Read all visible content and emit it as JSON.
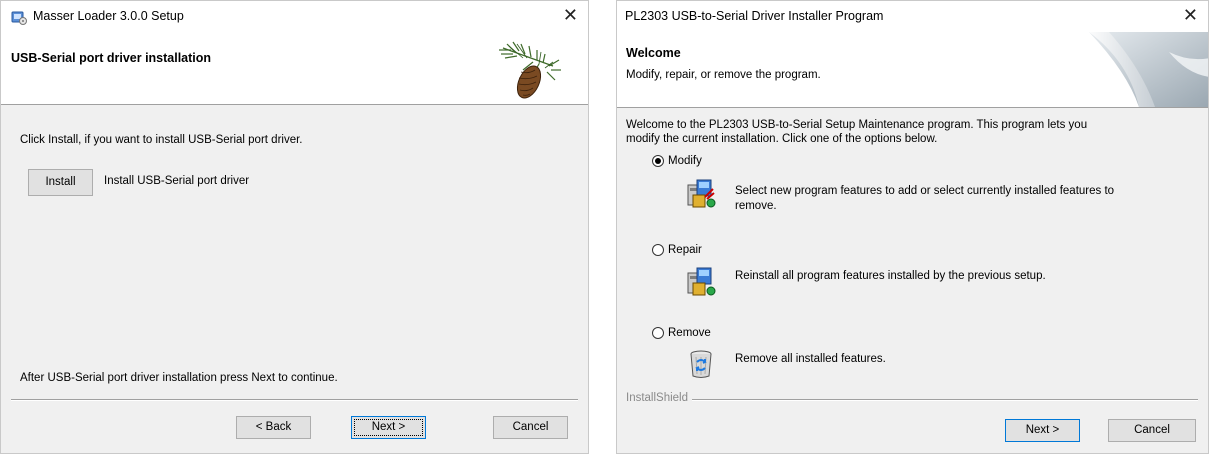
{
  "left": {
    "title": "Masser Loader 3.0.0 Setup",
    "header": "USB-Serial port driver installation",
    "instruction": "Click Install, if you want to install USB-Serial port driver.",
    "install_button": "Install",
    "install_desc": "Install USB-Serial port driver",
    "footer_note": "After USB-Serial port driver installation press Next to continue.",
    "back_button": "< Back",
    "next_button": "Next >",
    "cancel_button": "Cancel"
  },
  "right": {
    "title": "PL2303 USB-to-Serial Driver Installer Program",
    "header": "Welcome",
    "subheader": "Modify, repair, or remove the program.",
    "intro_line1": "Welcome to the PL2303 USB-to-Serial Setup Maintenance program. This program lets you",
    "intro_line2": "modify the current installation. Click one of the options below.",
    "options": [
      {
        "label": "Modify",
        "selected": true,
        "desc1": "Select new program features to add or select currently installed features to",
        "desc2": "remove."
      },
      {
        "label": "Repair",
        "selected": false,
        "desc1": "Reinstall all program features installed by the previous setup.",
        "desc2": ""
      },
      {
        "label": "Remove",
        "selected": false,
        "desc1": "Remove all installed features.",
        "desc2": ""
      }
    ],
    "brand": "InstallShield",
    "next_button": "Next >",
    "cancel_button": "Cancel"
  }
}
